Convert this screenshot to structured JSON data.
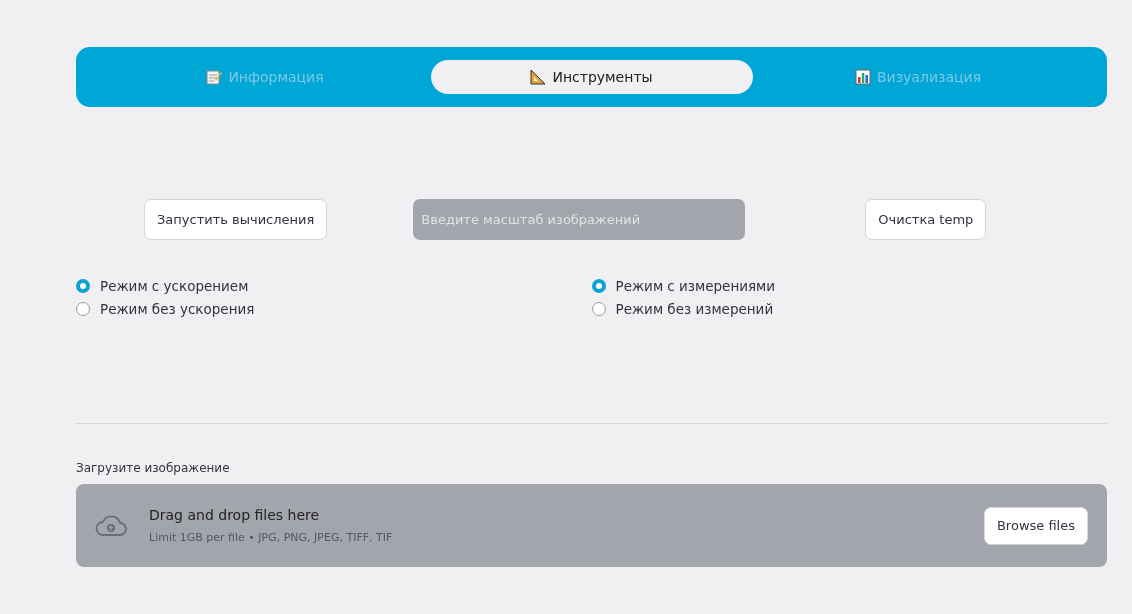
{
  "tabs": [
    {
      "label": "Информация",
      "kind": "memo",
      "selected": false
    },
    {
      "label": "Инструменты",
      "kind": "ruler",
      "selected": true
    },
    {
      "label": "Визуализация",
      "kind": "chart",
      "selected": false
    }
  ],
  "run_button": "Запустить вычисления",
  "scale_field": {
    "placeholder": "Введите масштаб изображений"
  },
  "clear_button": "Очистка temp",
  "radio_groups": [
    [
      {
        "label": "Режим с ускорением",
        "selected": true
      },
      {
        "label": "Режим без ускорения",
        "selected": false
      }
    ],
    [
      {
        "label": "Режим с измерениями",
        "selected": true
      },
      {
        "label": "Режим без измерений",
        "selected": false
      }
    ]
  ],
  "uploader": {
    "label": "Загрузите изображение",
    "title": "Drag and drop files here",
    "hint": "Limit 1GB per file • JPG, PNG, JPEG, TIFF, TIF",
    "button": "Browse files"
  }
}
